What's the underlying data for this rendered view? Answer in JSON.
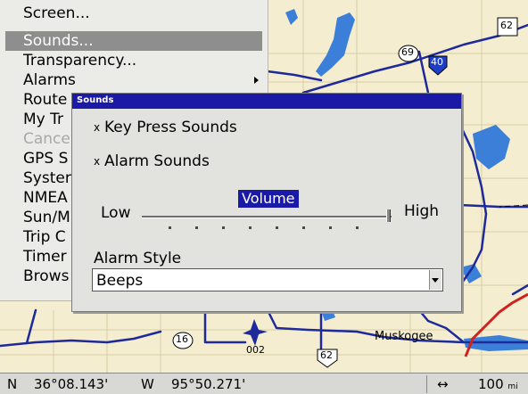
{
  "menu": {
    "items": [
      {
        "label": "Screen..."
      },
      {
        "label": "Sounds...",
        "selected": true
      },
      {
        "label": "Transparency..."
      },
      {
        "label": "Alarms",
        "has_submenu": true
      },
      {
        "label": "Route"
      },
      {
        "label": "My Tr"
      },
      {
        "label": "Cance",
        "disabled": true
      },
      {
        "label": "GPS S"
      },
      {
        "label": "Syster"
      },
      {
        "label": "NMEA"
      },
      {
        "label": "Sun/M"
      },
      {
        "label": "Trip C"
      },
      {
        "label": "Timer"
      },
      {
        "label": "Brows"
      }
    ]
  },
  "dialog": {
    "title": "Sounds",
    "key_press_sounds": {
      "label": "Key Press Sounds",
      "checked": true,
      "mark": "x"
    },
    "alarm_sounds": {
      "label": "Alarm Sounds",
      "checked": true,
      "mark": "x"
    },
    "volume": {
      "label": "Volume",
      "low_label": "Low",
      "high_label": "High",
      "level": 1.0
    },
    "alarm_style": {
      "label": "Alarm Style",
      "value": "Beeps"
    }
  },
  "map": {
    "labels": {
      "city": "Muskogee",
      "route_002": "002"
    },
    "shields": {
      "r69": "69",
      "r62": "62",
      "r16": "16",
      "i40": "40",
      "us62": "62"
    }
  },
  "status_bar": {
    "lat_hemisphere": "N",
    "lat_value": "36°08.143'",
    "lon_hemisphere": "W",
    "lon_value": "95°50.271'",
    "zoom_icon": "↔",
    "scale_value": "100",
    "scale_unit": "mi"
  },
  "colors": {
    "title_bar": "#1a1aa6",
    "map_bg": "#f4edcf",
    "water": "#3c7fd8",
    "road": "#1e2a9a"
  }
}
